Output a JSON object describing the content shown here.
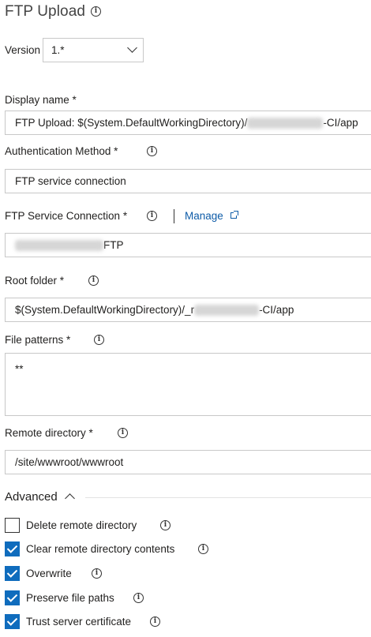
{
  "task": {
    "title": "FTP Upload",
    "version_label": "Version",
    "version_value": "1.*"
  },
  "display_name": {
    "label": "Display name *",
    "value_prefix": "FTP Upload: $(System.DefaultWorkingDirectory)/",
    "value_suffix": "-CI/app"
  },
  "auth_method": {
    "label": "Authentication Method *",
    "value": "FTP service connection"
  },
  "service_connection": {
    "label": "FTP Service Connection *",
    "manage_label": "Manage",
    "value_suffix": "FTP"
  },
  "root_folder": {
    "label": "Root folder *",
    "value_prefix": "$(System.DefaultWorkingDirectory)/_r",
    "value_suffix": "-CI/app"
  },
  "file_patterns": {
    "label": "File patterns *",
    "value": "**"
  },
  "remote_directory": {
    "label": "Remote directory *",
    "value": "/site/wwwroot/wwwroot"
  },
  "advanced": {
    "label": "Advanced",
    "options": [
      {
        "label": "Delete remote directory",
        "checked": false
      },
      {
        "label": "Clear remote directory contents",
        "checked": true
      },
      {
        "label": "Overwrite",
        "checked": true
      },
      {
        "label": "Preserve file paths",
        "checked": true
      },
      {
        "label": "Trust server certificate",
        "checked": true
      }
    ]
  },
  "colors": {
    "accent": "#0f6cbd",
    "link": "#0e5ca8",
    "border": "#c8c8c8"
  }
}
